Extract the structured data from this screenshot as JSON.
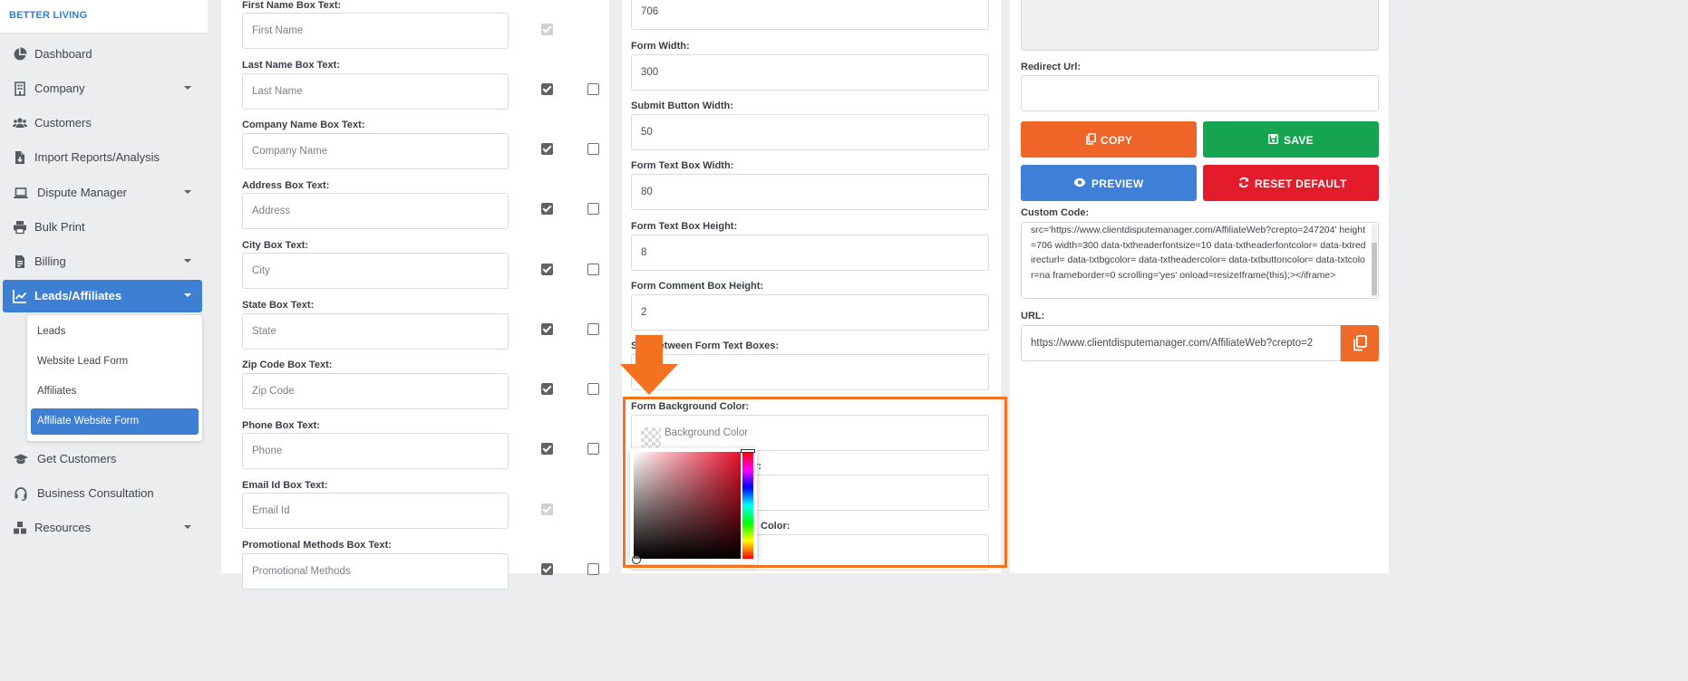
{
  "sidebar": {
    "brand": "BETTER LIVING",
    "items": [
      {
        "label": "Dashboard",
        "icon": "pie-chart-icon"
      },
      {
        "label": "Company",
        "icon": "building-icon",
        "has_dropdown": true
      },
      {
        "label": "Customers",
        "icon": "users-icon"
      },
      {
        "label": "Import Reports/Analysis",
        "icon": "file-import-icon"
      },
      {
        "label": "Dispute Manager",
        "icon": "laptop-icon",
        "has_dropdown": true
      },
      {
        "label": "Bulk Print",
        "icon": "printer-icon"
      },
      {
        "label": "Billing",
        "icon": "invoice-icon",
        "has_dropdown": true
      },
      {
        "label": "Leads/Affiliates",
        "icon": "line-chart-icon",
        "has_dropdown": true,
        "active": true
      },
      {
        "label": "Get Customers",
        "icon": "graduation-cap-icon"
      },
      {
        "label": "Business Consultation",
        "icon": "headset-icon"
      },
      {
        "label": "Resources",
        "icon": "boxes-icon",
        "has_dropdown": true
      }
    ],
    "submenu": [
      {
        "label": "Leads"
      },
      {
        "label": "Website Lead Form"
      },
      {
        "label": "Affiliates"
      },
      {
        "label": "Affiliate Website Form",
        "active": true
      }
    ]
  },
  "fields": [
    {
      "label": "First Name Box Text:",
      "placeholder": "First Name"
    },
    {
      "label": "Last Name Box Text:",
      "placeholder": "Last Name"
    },
    {
      "label": "Company Name Box Text:",
      "placeholder": "Company Name"
    },
    {
      "label": "Address Box Text:",
      "placeholder": "Address"
    },
    {
      "label": "City Box Text:",
      "placeholder": "City"
    },
    {
      "label": "State Box Text:",
      "placeholder": "State"
    },
    {
      "label": "Zip Code Box Text:",
      "placeholder": "Zip Code"
    },
    {
      "label": "Phone Box Text:",
      "placeholder": "Phone"
    },
    {
      "label": "Email Id Box Text:",
      "placeholder": "Email Id"
    },
    {
      "label": "Promotional Methods Box Text:",
      "placeholder": "Promotional Methods"
    }
  ],
  "settings": {
    "form_height_value": "706",
    "items": [
      {
        "label": "Form Width:",
        "value": "300"
      },
      {
        "label": "Submit Button Width:",
        "value": "50"
      },
      {
        "label": "Form Text Box Width:",
        "value": "80"
      },
      {
        "label": "Form Text Box Height:",
        "value": "8"
      },
      {
        "label": "Form Comment Box Height:",
        "value": "2"
      },
      {
        "label": "Space Between Form Text Boxes:",
        "visible_label": "S     Between Form Text Boxes:",
        "value": ""
      }
    ],
    "background_color_label": "Form Background Color:",
    "background_color_placeholder": "Background Color",
    "hidden_label_1_tail": "r:",
    "hidden_label_2_tail": "Color:"
  },
  "right": {
    "redirect_label": "Redirect Url:",
    "buttons": {
      "copy": "COPY",
      "save": "SAVE",
      "preview": "PREVIEW",
      "reset": "RESET DEFAULT"
    },
    "custom_code_label": "Custom Code:",
    "custom_code": "src='https://www.clientdisputemanager.com/AffiliateWeb?crepto=247204' height=706 width=300 data-txtheaderfontsize=10 data-txtheaderfontcolor= data-txtredirecturl= data-txtbgcolor= data-txtheadercolor= data-txtbuttoncolor= data-txtcolor=na frameborder=0  scrolling='yes' onload=resizeIframe(this);></iframe>",
    "url_label": "URL:",
    "url_value": "https://www.clientdisputemanager.com/AffiliateWeb?crepto=2"
  },
  "colors": {
    "primary": "#3c7fd3",
    "copy": "#ef6427",
    "save": "#16a450",
    "preview": "#3f7fd7",
    "reset": "#e41b2a",
    "annotation": "#f3711f"
  }
}
